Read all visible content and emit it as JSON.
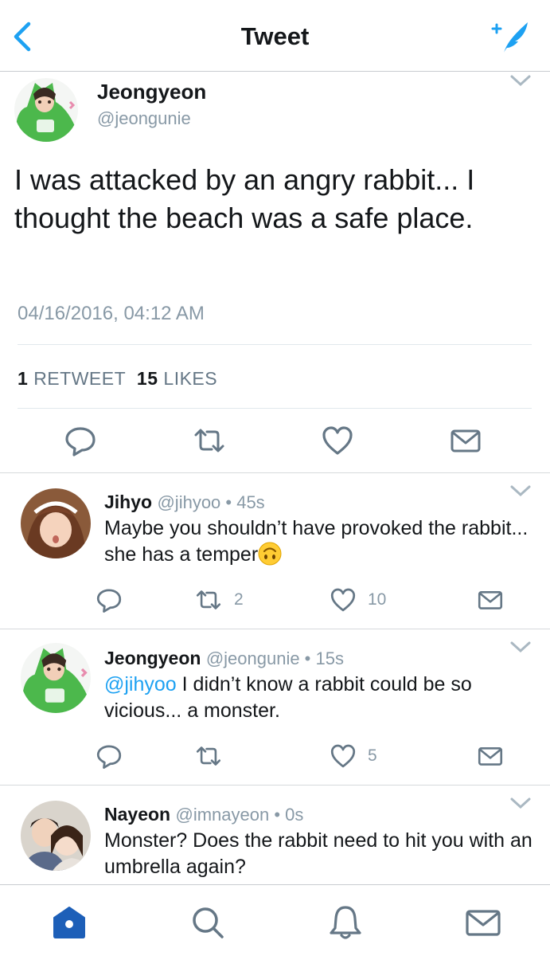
{
  "nav": {
    "title": "Tweet",
    "back_icon": "chevron-left-icon",
    "compose_icon": "compose-tweet-icon"
  },
  "colors": {
    "accent": "#1da1f2",
    "secondary_text": "#8899a6",
    "divider": "#e1e8ed"
  },
  "main_tweet": {
    "name": "Jeongyeon",
    "handle": "@jeongunie",
    "text": "I was attacked by an angry rabbit... I thought the beach was a safe place.",
    "timestamp": "04/16/2016, 04:12 AM",
    "retweet_count": "1",
    "retweet_label": "RETWEET",
    "likes_count": "15",
    "likes_label": "LIKES"
  },
  "replies": [
    {
      "name": "Jihyo",
      "meta": "@jihyoo • 45s",
      "text": "Maybe you shouldn’t have provoked the rabbit... she has a temper",
      "emoji": "upside-down-face",
      "retweets": "2",
      "likes": "10"
    },
    {
      "name": "Jeongyeon",
      "meta": "@jeongunie • 15s",
      "mention": "@jihyoo",
      "text": " I didn’t know a rabbit could be so vicious... a monster.",
      "retweets": "",
      "likes": "5"
    },
    {
      "name": "Nayeon",
      "meta": "@imnayeon • 0s",
      "text": "Monster? Does the rabbit need to hit you with an umbrella again?"
    }
  ],
  "tabbar": {
    "items": [
      "home-icon",
      "search-icon",
      "notifications-icon",
      "messages-icon"
    ]
  }
}
